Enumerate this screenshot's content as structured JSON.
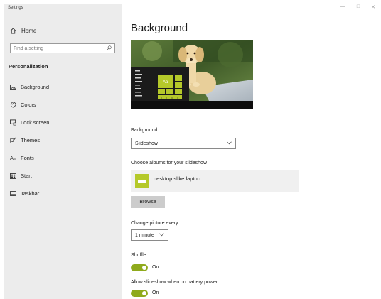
{
  "window": {
    "app_title": "Settings",
    "controls": {
      "minimize": "—",
      "maximize": "□",
      "close": "✕"
    }
  },
  "sidebar": {
    "home_label": "Home",
    "search_placeholder": "Find a setting",
    "section_title": "Personalization",
    "items": [
      {
        "label": "Background",
        "icon": "picture-icon"
      },
      {
        "label": "Colors",
        "icon": "palette-icon"
      },
      {
        "label": "Lock screen",
        "icon": "lock-screen-icon"
      },
      {
        "label": "Themes",
        "icon": "brush-icon"
      },
      {
        "label": "Fonts",
        "icon": "fonts-icon"
      },
      {
        "label": "Start",
        "icon": "start-icon"
      },
      {
        "label": "Taskbar",
        "icon": "taskbar-icon"
      }
    ]
  },
  "main": {
    "page_title": "Background",
    "preview": {
      "tile_text": "Aa",
      "accent_color": "#b5c92a"
    },
    "background_label": "Background",
    "background_value": "Slideshow",
    "albums_label": "Choose albums for your slideshow",
    "album_name": "desktop slike laptop",
    "browse_label": "Browse",
    "change_label": "Change picture every",
    "change_value": "1 minute",
    "shuffle_label": "Shuffle",
    "shuffle_state": "On",
    "battery_label": "Allow slideshow when on battery power",
    "battery_state": "On"
  },
  "colors": {
    "accent": "#8faa1c",
    "sidebar_bg": "#ececec"
  }
}
